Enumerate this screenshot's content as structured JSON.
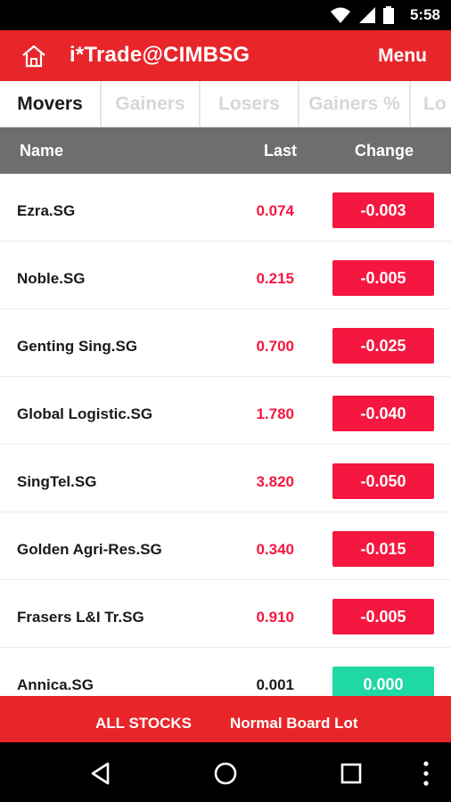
{
  "status_bar": {
    "time": "5:58"
  },
  "app_bar": {
    "title": "i*Trade@CIMBSG",
    "menu_label": "Menu"
  },
  "tabs": [
    {
      "label": "Movers",
      "active": true
    },
    {
      "label": "Gainers",
      "active": false
    },
    {
      "label": "Losers",
      "active": false
    },
    {
      "label": "Gainers %",
      "active": false
    },
    {
      "label": "Lo",
      "active": false
    }
  ],
  "table": {
    "headers": {
      "name": "Name",
      "last": "Last",
      "change": "Change"
    },
    "rows": [
      {
        "name": "Ezra.SG",
        "last": "0.074",
        "change": "-0.003",
        "direction": "down"
      },
      {
        "name": "Noble.SG",
        "last": "0.215",
        "change": "-0.005",
        "direction": "down"
      },
      {
        "name": "Genting Sing.SG",
        "last": "0.700",
        "change": "-0.025",
        "direction": "down"
      },
      {
        "name": "Global Logistic.SG",
        "last": "1.780",
        "change": "-0.040",
        "direction": "down"
      },
      {
        "name": "SingTel.SG",
        "last": "3.820",
        "change": "-0.050",
        "direction": "down"
      },
      {
        "name": "Golden Agri-Res.SG",
        "last": "0.340",
        "change": "-0.015",
        "direction": "down"
      },
      {
        "name": "Frasers L&I Tr.SG",
        "last": "0.910",
        "change": "-0.005",
        "direction": "down"
      },
      {
        "name": "Annica.SG",
        "last": "0.001",
        "change": "0.000",
        "direction": "flat"
      }
    ]
  },
  "bottom_bar": {
    "filter_label": "ALL STOCKS",
    "board_label": "Normal Board Lot"
  },
  "colors": {
    "brand_red": "#e8262a",
    "down_red": "#f5173f",
    "flat_green": "#1fd8a4",
    "header_gray": "#6e6e6e"
  },
  "icons": {
    "home": "home-icon",
    "wifi": "wifi-icon",
    "signal": "signal-icon",
    "battery": "battery-icon",
    "back": "back-icon",
    "home_nav": "home-circle-icon",
    "recents": "recents-icon",
    "overflow": "overflow-menu-icon"
  }
}
